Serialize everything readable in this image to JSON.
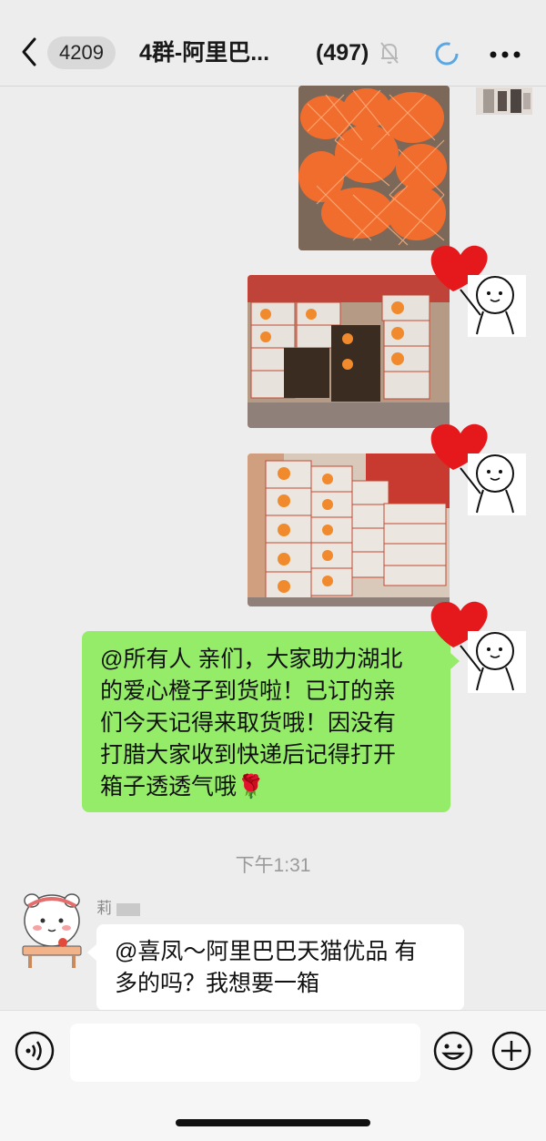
{
  "header": {
    "unread_count": "4209",
    "title": "4群-阿里巴...",
    "member_count": "(497)"
  },
  "messages": [
    {
      "type": "image",
      "description": "oranges in foam nets"
    },
    {
      "type": "image",
      "description": "stacked orange gift boxes"
    },
    {
      "type": "image",
      "description": "stacked orange gift boxes"
    },
    {
      "type": "text",
      "side": "right",
      "lines": [
        "@所有人 亲们，大家助力湖北",
        "的爱心橙子到货啦！已订的亲",
        "们今天记得来取货哦！因没有",
        "打腊大家收到快递后记得打开",
        "箱子透透气哦🌹"
      ]
    },
    {
      "type": "time",
      "text": "下午1:31"
    },
    {
      "type": "text",
      "side": "left",
      "sender": "莉",
      "lines": [
        "@喜凤～阿里巴巴天猫优品 有",
        "多的吗？我想要一箱"
      ]
    }
  ],
  "input": {
    "placeholder": ""
  },
  "colors": {
    "own_bubble": "#95ec69",
    "other_bubble": "#ffffff",
    "background": "#ededed"
  }
}
